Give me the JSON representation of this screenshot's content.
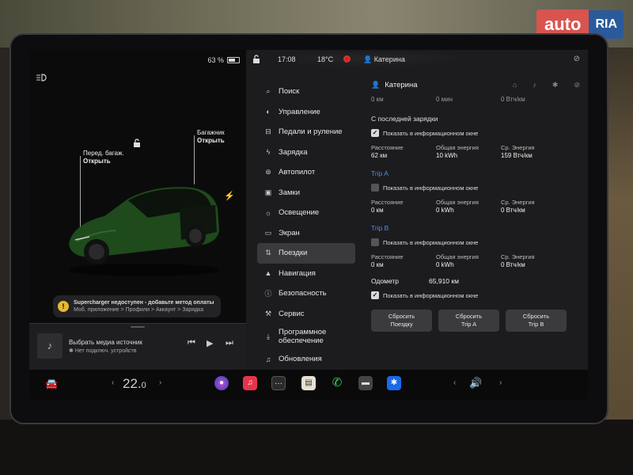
{
  "watermark": {
    "auto": "auto",
    "ria": "RIA"
  },
  "left": {
    "battery_pct": "63 %",
    "battery_level": 0.63,
    "callout_frunk": {
      "line1": "Перед. багаж.",
      "line2": "Открыть"
    },
    "callout_trunk": {
      "line1": "Багажник",
      "line2": "Открыть"
    },
    "alert": {
      "title": "Supercharger недоступен - добавьте метод оплаты",
      "path": "Моб. приложение > Профили > Аккаунт > Зарядка"
    },
    "media": {
      "title": "Выбрать медиа источник",
      "subtitle": "Нет подключ. устройств"
    }
  },
  "status": {
    "time": "17:08",
    "temp": "18°C",
    "user": "Катерина"
  },
  "menu": [
    {
      "label": "Поиск",
      "icon": "search-icon"
    },
    {
      "label": "Управление",
      "icon": "toggle-icon"
    },
    {
      "label": "Педали и руление",
      "icon": "car-icon"
    },
    {
      "label": "Зарядка",
      "icon": "bolt-icon"
    },
    {
      "label": "Автопилот",
      "icon": "steering-icon"
    },
    {
      "label": "Замки",
      "icon": "lock-icon"
    },
    {
      "label": "Освещение",
      "icon": "sun-icon"
    },
    {
      "label": "Экран",
      "icon": "screen-icon"
    },
    {
      "label": "Поездки",
      "icon": "trips-icon"
    },
    {
      "label": "Навигация",
      "icon": "nav-icon"
    },
    {
      "label": "Безопасность",
      "icon": "safety-icon"
    },
    {
      "label": "Сервис",
      "icon": "wrench-icon"
    },
    {
      "label": "Программное обеспечение",
      "icon": "download-icon"
    },
    {
      "label": "Обновления",
      "icon": "bell-icon"
    }
  ],
  "content": {
    "user": "Катерина",
    "zero": [
      "0 км",
      "0 мин",
      "0 Втч/км"
    ],
    "since_charge": {
      "label": "С последней зарядки",
      "show": "Показать в информационном окне",
      "stats": [
        {
          "label": "Расстояние",
          "value": "62 км"
        },
        {
          "label": "Общая энергия",
          "value": "10 kWh"
        },
        {
          "label": "Ср. Энергия",
          "value": "159 Втч/км"
        }
      ]
    },
    "trip_a": {
      "label": "Trip A",
      "show": "Показать в информационном окне",
      "stats": [
        {
          "label": "Расстояние",
          "value": "0 км"
        },
        {
          "label": "Общая энергия",
          "value": "0 kWh"
        },
        {
          "label": "Ср. Энергия",
          "value": "0 Втч/км"
        }
      ]
    },
    "trip_b": {
      "label": "Trip B",
      "show": "Показать в информационном окне",
      "stats": [
        {
          "label": "Расстояние",
          "value": "0 км"
        },
        {
          "label": "Общая энергия",
          "value": "0 kWh"
        },
        {
          "label": "Ср. Энергия",
          "value": "0 Втч/км"
        }
      ]
    },
    "odometer": {
      "label": "Одометр",
      "value": "65,910 км",
      "show": "Показать в информационном окне"
    },
    "buttons": [
      {
        "line1": "Сбросить",
        "line2": "Поездку"
      },
      {
        "line1": "Сбросить",
        "line2": "Trip A"
      },
      {
        "line1": "Сбросить",
        "line2": "Trip B"
      }
    ]
  },
  "bottom": {
    "temp_int": "22.",
    "temp_dec": "0"
  }
}
